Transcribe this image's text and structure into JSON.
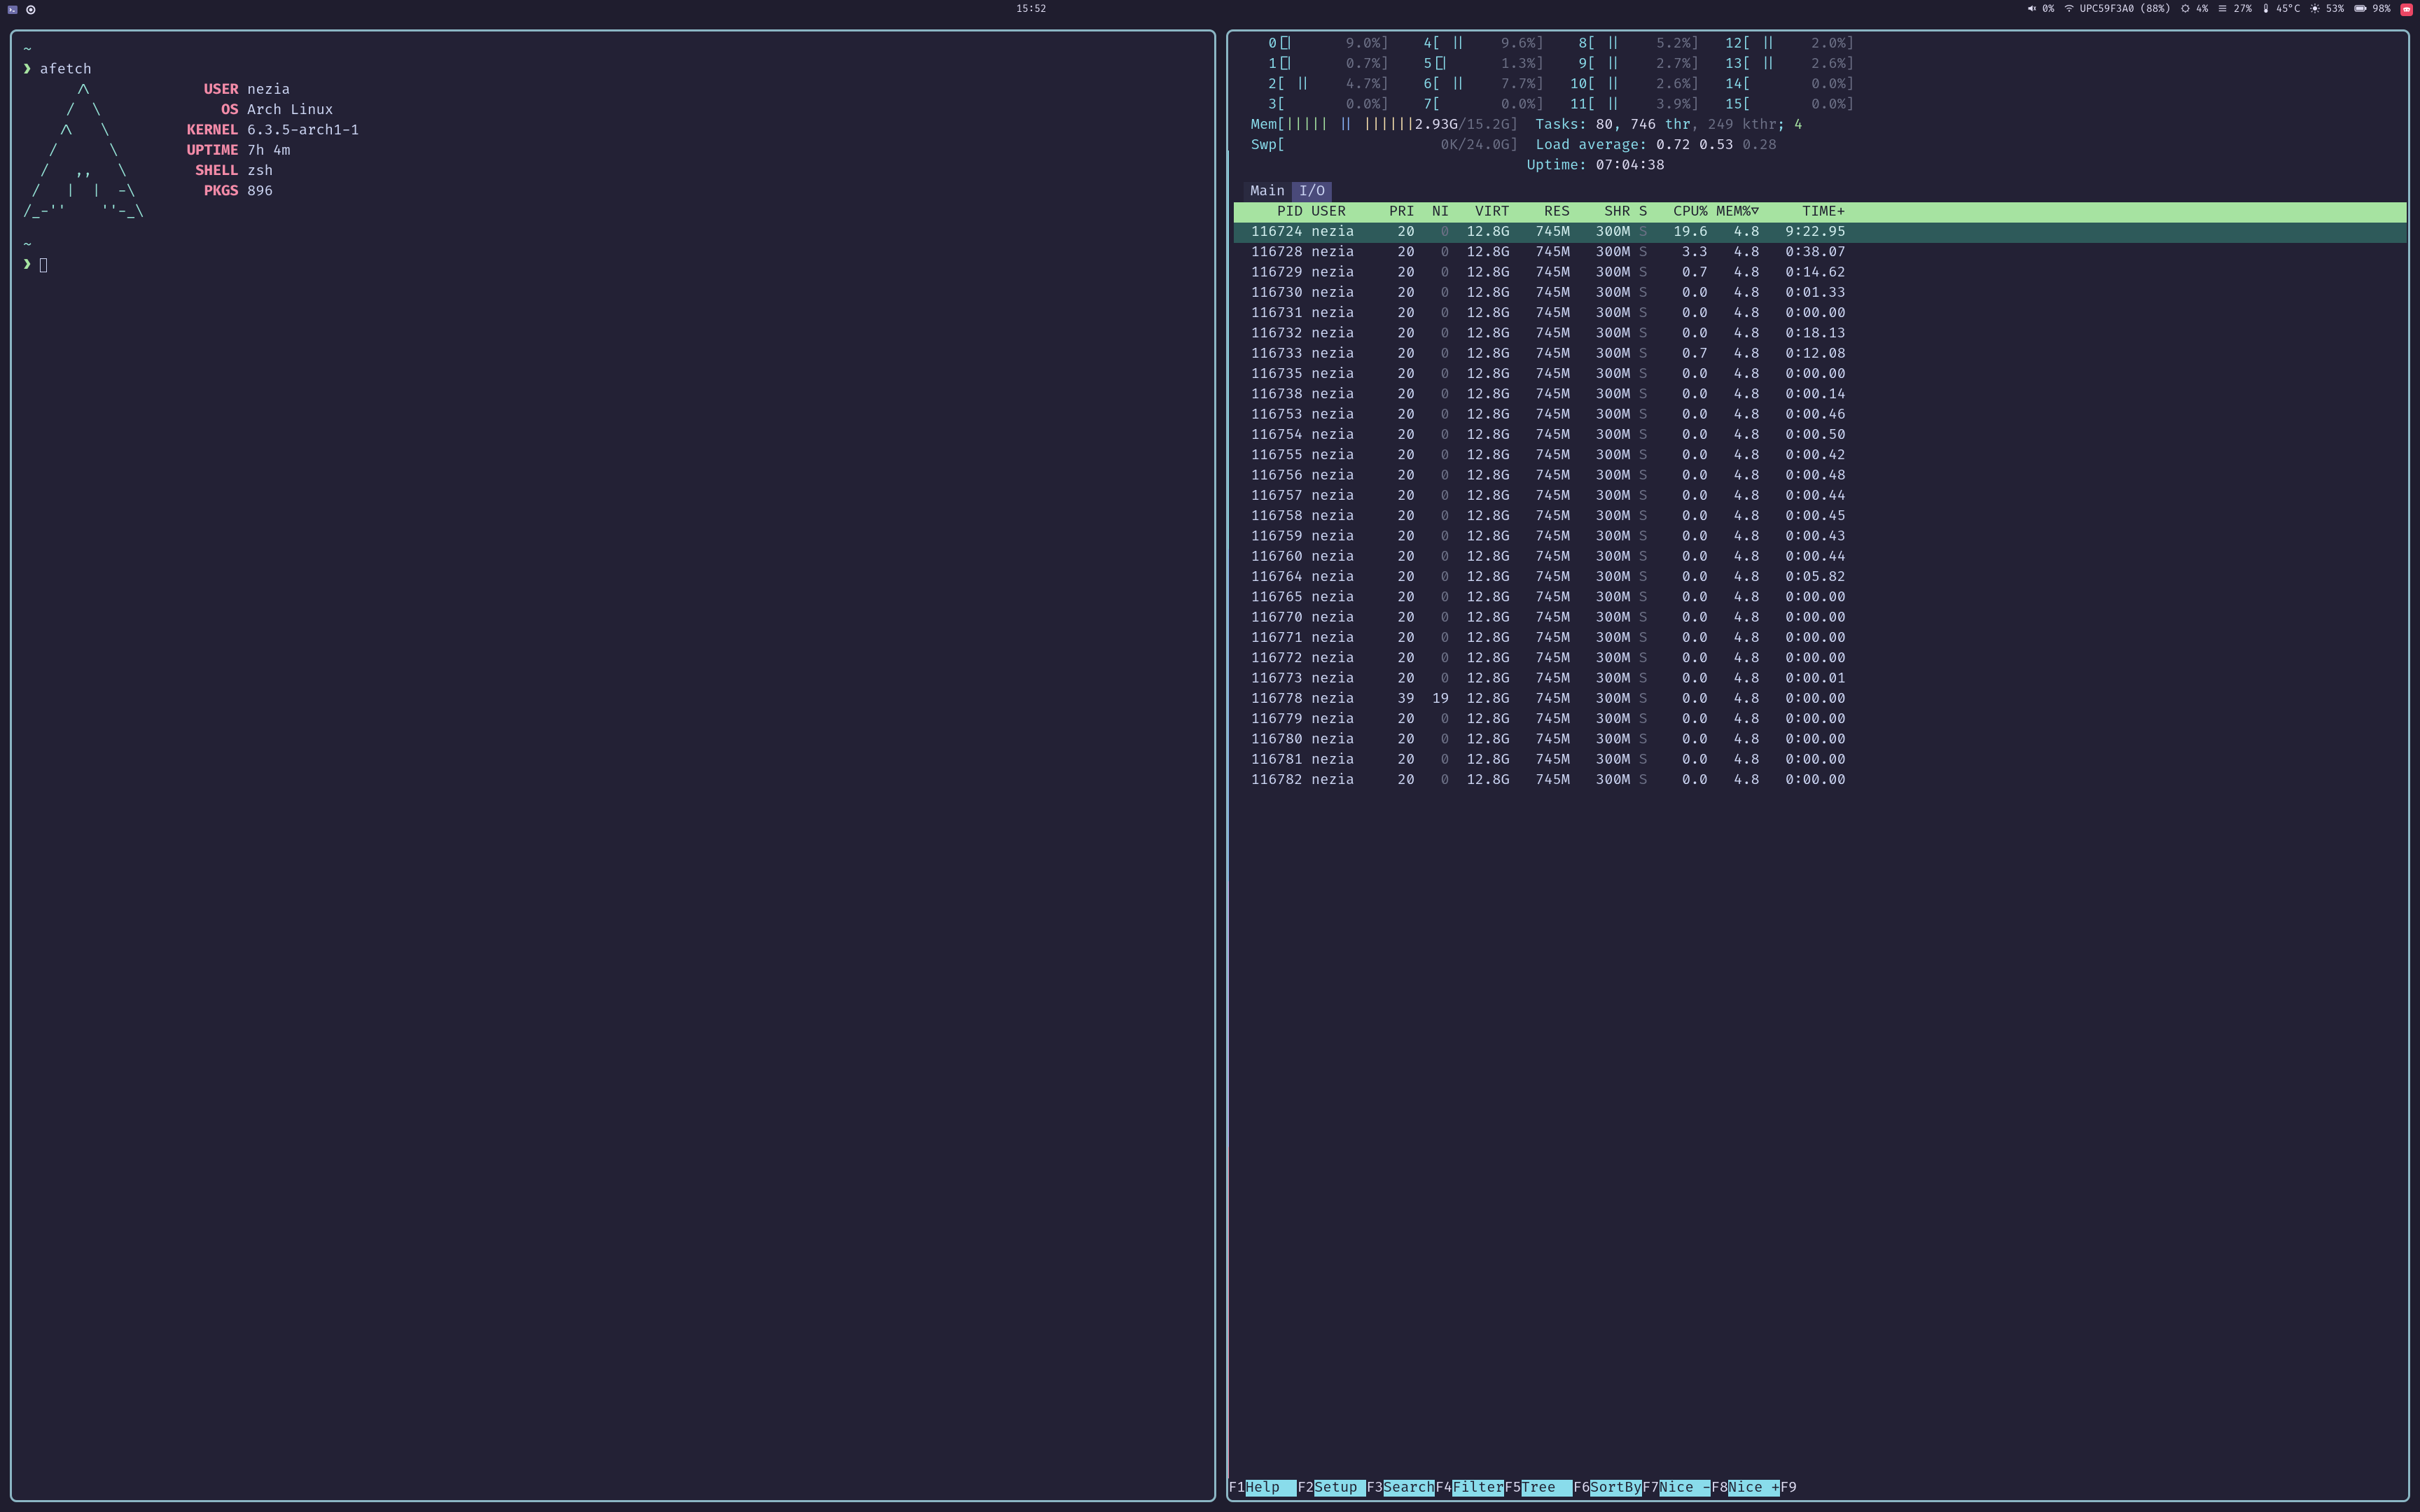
{
  "topbar": {
    "clock": "15:52",
    "volume_pct": "0%",
    "wifi": "UPC59F3A0 (88%)",
    "cpu_pct": "4%",
    "misc_pct": "27%",
    "temp": "45°C",
    "brightness_pct": "53%",
    "battery_pct": "98%"
  },
  "afetch": {
    "command": "afetch",
    "keys": {
      "user": "USER",
      "os": "OS",
      "kernel": "KERNEL",
      "uptime": "UPTIME",
      "shell": "SHELL",
      "pkgs": "PKGS"
    },
    "vals": {
      "user": "nezia",
      "os": "Arch Linux",
      "kernel": "6.3.5-arch1-1",
      "uptime": "7h 4m",
      "shell": "zsh",
      "pkgs": "896"
    },
    "ascii": [
      "      /\\         ",
      "     /  \\        ",
      "    /\\   \\       ",
      "   /      \\      ",
      "  /   ,,   \\     ",
      " /   |  |  -\\    ",
      "/_-''    ''-_\\   "
    ]
  },
  "htop": {
    "cpus": [
      {
        "n": "0",
        "bar": "[|",
        "pct": " 9.0%"
      },
      {
        "n": "1",
        "bar": "[|",
        "pct": " 0.7%"
      },
      {
        "n": "2",
        "bar": "[ ||",
        "pct": " 4.7%"
      },
      {
        "n": "3",
        "bar": "[",
        "pct": " 0.0%"
      },
      {
        "n": "4",
        "bar": "[ ||",
        "pct": " 9.6%"
      },
      {
        "n": "5",
        "bar": "[|",
        "pct": " 1.3%"
      },
      {
        "n": "6",
        "bar": "[ ||",
        "pct": " 7.7%"
      },
      {
        "n": "7",
        "bar": "[",
        "pct": " 0.0%"
      },
      {
        "n": "8",
        "bar": "[ ||",
        "pct": " 5.2%"
      },
      {
        "n": "9",
        "bar": "[ ||",
        "pct": " 2.7%"
      },
      {
        "n": "10",
        "bar": "[ ||",
        "pct": " 2.6%"
      },
      {
        "n": "11",
        "bar": "[ ||",
        "pct": " 3.9%"
      },
      {
        "n": "12",
        "bar": "[ ||",
        "pct": " 2.0%"
      },
      {
        "n": "13",
        "bar": "[ ||",
        "pct": " 2.6%"
      },
      {
        "n": "14",
        "bar": "[",
        "pct": " 0.0%"
      },
      {
        "n": "15",
        "bar": "[",
        "pct": " 0.0%"
      }
    ],
    "mem_used": "2.93G",
    "mem_total": "15.2G",
    "swp_used": "0K",
    "swp_total": "24.0G",
    "tasks": "80",
    "threads": "746",
    "kthr": "249",
    "running": "4",
    "load": [
      "0.72",
      "0.53",
      "0.28"
    ],
    "uptime": "07:04:38",
    "tabs": {
      "main": "Main",
      "io": "I/O"
    },
    "headers": {
      "pid": "PID",
      "user": "USER",
      "pri": "PRI",
      "ni": "NI",
      "virt": "VIRT",
      "res": "RES",
      "shr": "SHR",
      "s": "S",
      "cpu": "CPU%",
      "mem": "MEM%▽",
      "time": "TIME+"
    },
    "processes": [
      {
        "pid": "116724",
        "user": "nezia",
        "pri": "20",
        "ni": "0",
        "virt": "12.8G",
        "res": "745M",
        "shr": "300M",
        "s": "S",
        "cpu": "19.6",
        "mem": "4.8",
        "time": "9:22.95",
        "sel": true
      },
      {
        "pid": "116728",
        "user": "nezia",
        "pri": "20",
        "ni": "0",
        "virt": "12.8G",
        "res": "745M",
        "shr": "300M",
        "s": "S",
        "cpu": "3.3",
        "mem": "4.8",
        "time": "0:38.07"
      },
      {
        "pid": "116729",
        "user": "nezia",
        "pri": "20",
        "ni": "0",
        "virt": "12.8G",
        "res": "745M",
        "shr": "300M",
        "s": "S",
        "cpu": "0.7",
        "mem": "4.8",
        "time": "0:14.62"
      },
      {
        "pid": "116730",
        "user": "nezia",
        "pri": "20",
        "ni": "0",
        "virt": "12.8G",
        "res": "745M",
        "shr": "300M",
        "s": "S",
        "cpu": "0.0",
        "mem": "4.8",
        "time": "0:01.33"
      },
      {
        "pid": "116731",
        "user": "nezia",
        "pri": "20",
        "ni": "0",
        "virt": "12.8G",
        "res": "745M",
        "shr": "300M",
        "s": "S",
        "cpu": "0.0",
        "mem": "4.8",
        "time": "0:00.00"
      },
      {
        "pid": "116732",
        "user": "nezia",
        "pri": "20",
        "ni": "0",
        "virt": "12.8G",
        "res": "745M",
        "shr": "300M",
        "s": "S",
        "cpu": "0.0",
        "mem": "4.8",
        "time": "0:18.13"
      },
      {
        "pid": "116733",
        "user": "nezia",
        "pri": "20",
        "ni": "0",
        "virt": "12.8G",
        "res": "745M",
        "shr": "300M",
        "s": "S",
        "cpu": "0.7",
        "mem": "4.8",
        "time": "0:12.08"
      },
      {
        "pid": "116735",
        "user": "nezia",
        "pri": "20",
        "ni": "0",
        "virt": "12.8G",
        "res": "745M",
        "shr": "300M",
        "s": "S",
        "cpu": "0.0",
        "mem": "4.8",
        "time": "0:00.00"
      },
      {
        "pid": "116738",
        "user": "nezia",
        "pri": "20",
        "ni": "0",
        "virt": "12.8G",
        "res": "745M",
        "shr": "300M",
        "s": "S",
        "cpu": "0.0",
        "mem": "4.8",
        "time": "0:00.14"
      },
      {
        "pid": "116753",
        "user": "nezia",
        "pri": "20",
        "ni": "0",
        "virt": "12.8G",
        "res": "745M",
        "shr": "300M",
        "s": "S",
        "cpu": "0.0",
        "mem": "4.8",
        "time": "0:00.46"
      },
      {
        "pid": "116754",
        "user": "nezia",
        "pri": "20",
        "ni": "0",
        "virt": "12.8G",
        "res": "745M",
        "shr": "300M",
        "s": "S",
        "cpu": "0.0",
        "mem": "4.8",
        "time": "0:00.50"
      },
      {
        "pid": "116755",
        "user": "nezia",
        "pri": "20",
        "ni": "0",
        "virt": "12.8G",
        "res": "745M",
        "shr": "300M",
        "s": "S",
        "cpu": "0.0",
        "mem": "4.8",
        "time": "0:00.42"
      },
      {
        "pid": "116756",
        "user": "nezia",
        "pri": "20",
        "ni": "0",
        "virt": "12.8G",
        "res": "745M",
        "shr": "300M",
        "s": "S",
        "cpu": "0.0",
        "mem": "4.8",
        "time": "0:00.48"
      },
      {
        "pid": "116757",
        "user": "nezia",
        "pri": "20",
        "ni": "0",
        "virt": "12.8G",
        "res": "745M",
        "shr": "300M",
        "s": "S",
        "cpu": "0.0",
        "mem": "4.8",
        "time": "0:00.44"
      },
      {
        "pid": "116758",
        "user": "nezia",
        "pri": "20",
        "ni": "0",
        "virt": "12.8G",
        "res": "745M",
        "shr": "300M",
        "s": "S",
        "cpu": "0.0",
        "mem": "4.8",
        "time": "0:00.45"
      },
      {
        "pid": "116759",
        "user": "nezia",
        "pri": "20",
        "ni": "0",
        "virt": "12.8G",
        "res": "745M",
        "shr": "300M",
        "s": "S",
        "cpu": "0.0",
        "mem": "4.8",
        "time": "0:00.43"
      },
      {
        "pid": "116760",
        "user": "nezia",
        "pri": "20",
        "ni": "0",
        "virt": "12.8G",
        "res": "745M",
        "shr": "300M",
        "s": "S",
        "cpu": "0.0",
        "mem": "4.8",
        "time": "0:00.44"
      },
      {
        "pid": "116764",
        "user": "nezia",
        "pri": "20",
        "ni": "0",
        "virt": "12.8G",
        "res": "745M",
        "shr": "300M",
        "s": "S",
        "cpu": "0.0",
        "mem": "4.8",
        "time": "0:05.82"
      },
      {
        "pid": "116765",
        "user": "nezia",
        "pri": "20",
        "ni": "0",
        "virt": "12.8G",
        "res": "745M",
        "shr": "300M",
        "s": "S",
        "cpu": "0.0",
        "mem": "4.8",
        "time": "0:00.00"
      },
      {
        "pid": "116770",
        "user": "nezia",
        "pri": "20",
        "ni": "0",
        "virt": "12.8G",
        "res": "745M",
        "shr": "300M",
        "s": "S",
        "cpu": "0.0",
        "mem": "4.8",
        "time": "0:00.00"
      },
      {
        "pid": "116771",
        "user": "nezia",
        "pri": "20",
        "ni": "0",
        "virt": "12.8G",
        "res": "745M",
        "shr": "300M",
        "s": "S",
        "cpu": "0.0",
        "mem": "4.8",
        "time": "0:00.00"
      },
      {
        "pid": "116772",
        "user": "nezia",
        "pri": "20",
        "ni": "0",
        "virt": "12.8G",
        "res": "745M",
        "shr": "300M",
        "s": "S",
        "cpu": "0.0",
        "mem": "4.8",
        "time": "0:00.00"
      },
      {
        "pid": "116773",
        "user": "nezia",
        "pri": "20",
        "ni": "0",
        "virt": "12.8G",
        "res": "745M",
        "shr": "300M",
        "s": "S",
        "cpu": "0.0",
        "mem": "4.8",
        "time": "0:00.01"
      },
      {
        "pid": "116778",
        "user": "nezia",
        "pri": "39",
        "ni": "19",
        "virt": "12.8G",
        "res": "745M",
        "shr": "300M",
        "s": "S",
        "cpu": "0.0",
        "mem": "4.8",
        "time": "0:00.00"
      },
      {
        "pid": "116779",
        "user": "nezia",
        "pri": "20",
        "ni": "0",
        "virt": "12.8G",
        "res": "745M",
        "shr": "300M",
        "s": "S",
        "cpu": "0.0",
        "mem": "4.8",
        "time": "0:00.00"
      },
      {
        "pid": "116780",
        "user": "nezia",
        "pri": "20",
        "ni": "0",
        "virt": "12.8G",
        "res": "745M",
        "shr": "300M",
        "s": "S",
        "cpu": "0.0",
        "mem": "4.8",
        "time": "0:00.00"
      },
      {
        "pid": "116781",
        "user": "nezia",
        "pri": "20",
        "ni": "0",
        "virt": "12.8G",
        "res": "745M",
        "shr": "300M",
        "s": "S",
        "cpu": "0.0",
        "mem": "4.8",
        "time": "0:00.00"
      },
      {
        "pid": "116782",
        "user": "nezia",
        "pri": "20",
        "ni": "0",
        "virt": "12.8G",
        "res": "745M",
        "shr": "300M",
        "s": "S",
        "cpu": "0.0",
        "mem": "4.8",
        "time": "0:00.00"
      }
    ],
    "fkeys": [
      {
        "k": "F1",
        "l": "Help  "
      },
      {
        "k": "F2",
        "l": "Setup "
      },
      {
        "k": "F3",
        "l": "Search"
      },
      {
        "k": "F4",
        "l": "Filter"
      },
      {
        "k": "F5",
        "l": "Tree  "
      },
      {
        "k": "F6",
        "l": "SortBy"
      },
      {
        "k": "F7",
        "l": "Nice -"
      },
      {
        "k": "F8",
        "l": "Nice +"
      },
      {
        "k": "F9",
        "l": ""
      }
    ]
  }
}
